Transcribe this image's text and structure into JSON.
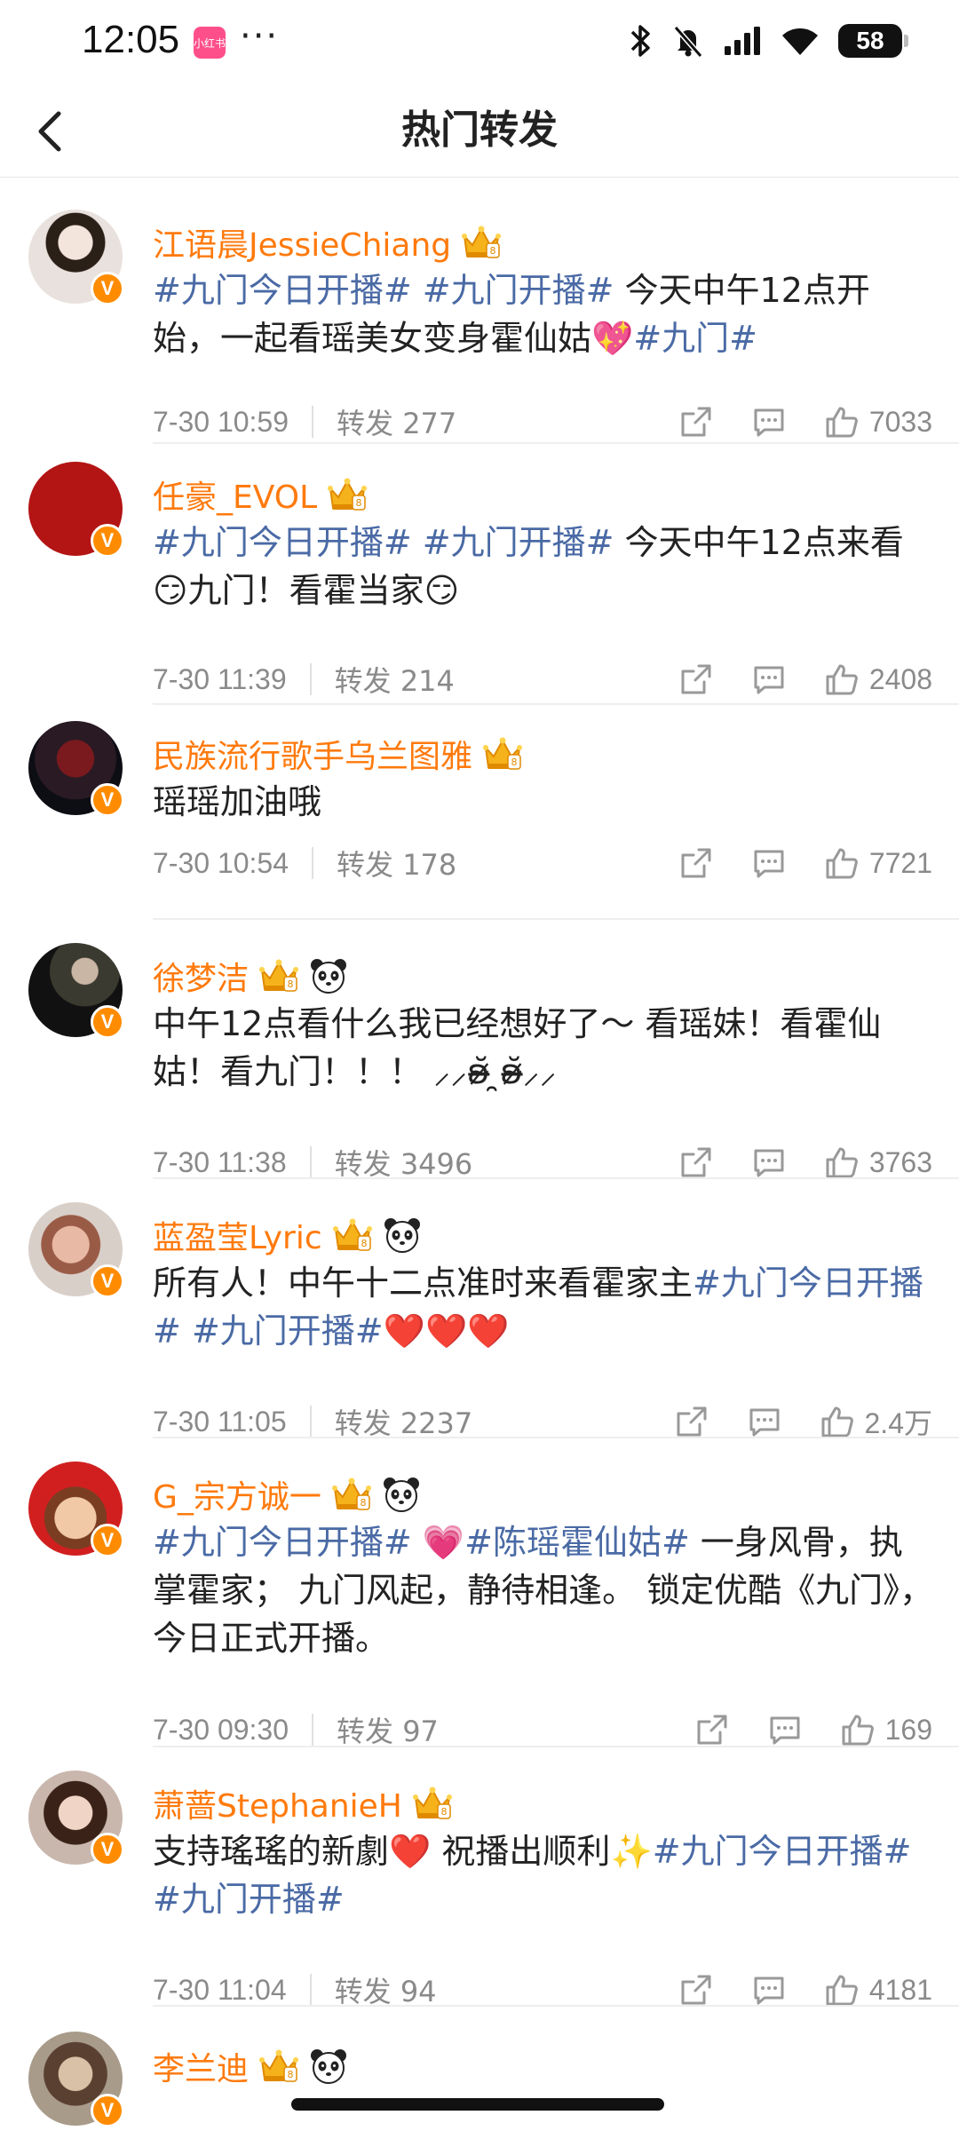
{
  "status_bar": {
    "time": "12:05",
    "app_badge": "小红书",
    "dots": "···",
    "battery": "58",
    "icons": [
      "bluetooth-icon",
      "mute-bell-icon",
      "signal-icon",
      "wifi-icon",
      "battery-icon"
    ]
  },
  "nav": {
    "title": "热门转发",
    "back_icon": "chevron-left-icon"
  },
  "colors": {
    "username": "#ff7a0d",
    "hashtag": "#4a6aa5",
    "meta": "#8a8a8a",
    "verified_badge": "#ff8c00"
  },
  "posts": [
    {
      "user": "江语晨JessieChiang",
      "badges": [
        "crown-icon"
      ],
      "text": [
        {
          "t": "#九门今日开播#",
          "c": "tag"
        },
        {
          "t": " "
        },
        {
          "t": "#九门开播#",
          "c": "tag"
        },
        {
          "t": " 今天中午12点开始，一起看瑶美女变身霍仙姑"
        },
        {
          "t": "💖",
          "c": "heart"
        },
        {
          "t": "#九门#",
          "c": "tag"
        }
      ],
      "time": "7-30 10:59",
      "repost": "转发 277",
      "likes": "7033"
    },
    {
      "user": "任豪_EVOL",
      "badges": [
        "crown-icon"
      ],
      "text": [
        {
          "t": "#九门今日开播#",
          "c": "tag"
        },
        {
          "t": " "
        },
        {
          "t": "#九门开播#",
          "c": "tag"
        },
        {
          "t": " 今天中午12点来看😏九门！看霍当家😏"
        }
      ],
      "time": "7-30 11:39",
      "repost": "转发 214",
      "likes": "2408"
    },
    {
      "user": "民族流行歌手乌兰图雅",
      "badges": [
        "crown-icon"
      ],
      "text": [
        {
          "t": "瑶瑶加油哦"
        }
      ],
      "time": "7-30 10:54",
      "repost": "转发 178",
      "likes": "7721"
    },
    {
      "user": "徐梦洁",
      "badges": [
        "crown-icon",
        "panda-icon"
      ],
      "text": [
        {
          "t": "中午12点看什么我已经想好了～ 看瑶妹！看霍仙姑！看九门！！！ ⸝⸝ʚ̴̶̷̆ ̯ʚ̴̶̷̆⸝⸝"
        }
      ],
      "time": "7-30 11:38",
      "repost": "转发 3496",
      "likes": "3763"
    },
    {
      "user": "蓝盈莹Lyric",
      "badges": [
        "crown-icon",
        "panda-icon"
      ],
      "text": [
        {
          "t": "所有人！中午十二点准时来看霍家主"
        },
        {
          "t": "#九门今日开播#",
          "c": "tag"
        },
        {
          "t": " "
        },
        {
          "t": "#九门开播#",
          "c": "tag"
        },
        {
          "t": "❤️❤️❤️",
          "c": "heart"
        }
      ],
      "time": "7-30 11:05",
      "repost": "转发 2237",
      "likes": "2.4万"
    },
    {
      "user": "G_宗方诚一",
      "badges": [
        "crown-icon",
        "panda-icon"
      ],
      "text": [
        {
          "t": "#九门今日开播#",
          "c": "tag"
        },
        {
          "t": " "
        },
        {
          "t": "💗",
          "c": "heart"
        },
        {
          "t": "#陈瑶霍仙姑#",
          "c": "tag"
        },
        {
          "t": " 一身风骨，执掌霍家； 九门风起，静待相逢。 锁定优酷《九门》，今日正式开播。"
        }
      ],
      "time": "7-30 09:30",
      "repost": "转发 97",
      "likes": "169"
    },
    {
      "user": "萧蔷StephanieH",
      "badges": [
        "crown-icon"
      ],
      "text": [
        {
          "t": "支持瑤瑤的新劇"
        },
        {
          "t": "❤️",
          "c": "heart"
        },
        {
          "t": " 祝播出顺利"
        },
        {
          "t": "✨",
          "c": "sparkle"
        },
        {
          "t": "#九门今日开播#",
          "c": "tag"
        },
        {
          "t": " "
        },
        {
          "t": "#九门开播#",
          "c": "tag"
        }
      ],
      "time": "7-30 11:04",
      "repost": "转发 94",
      "likes": "4181"
    },
    {
      "user": "李兰迪",
      "badges": [
        "crown-icon",
        "panda-icon"
      ],
      "text": [],
      "time": "",
      "repost": "",
      "likes": ""
    }
  ]
}
